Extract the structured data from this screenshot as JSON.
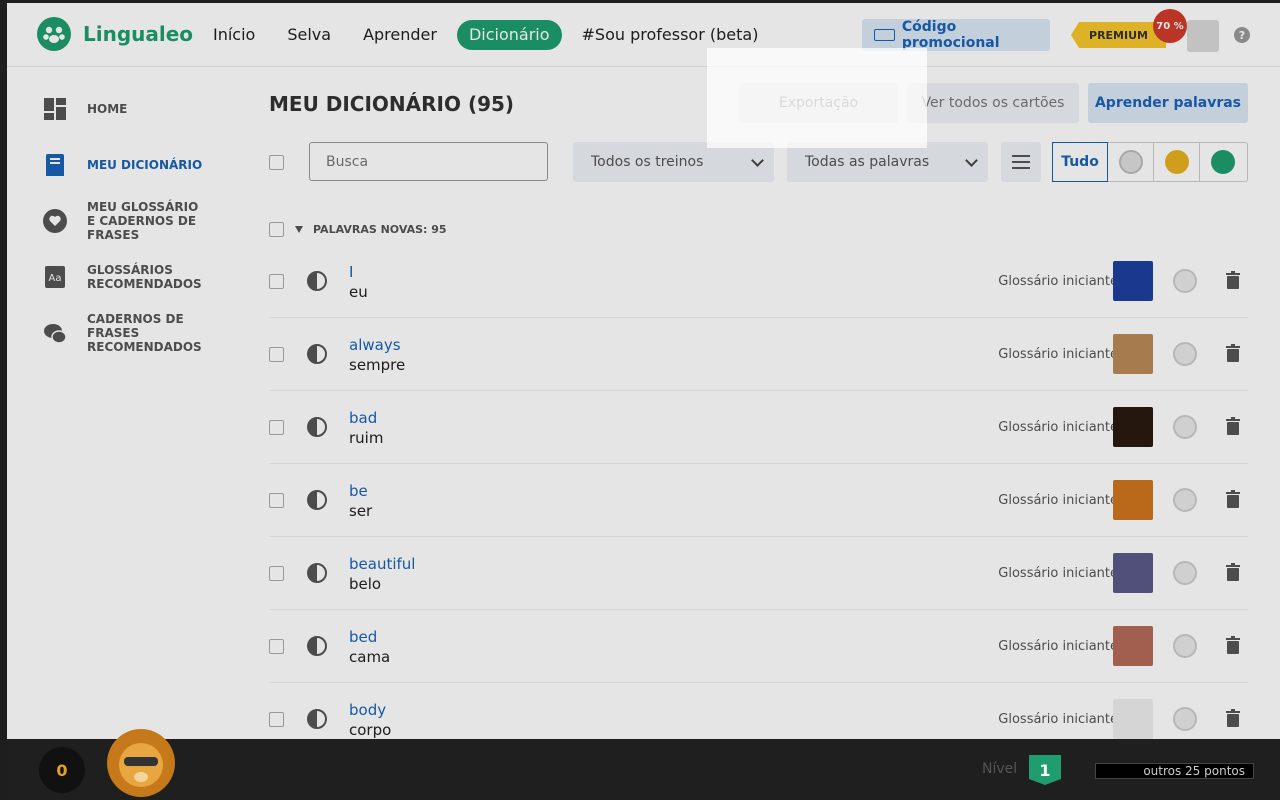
{
  "header": {
    "logo_text": "Lingualeo",
    "nav": [
      "Início",
      "Selva",
      "Aprender",
      "Dicionário",
      "#Sou professor (beta)"
    ],
    "promo_label": "Código promocional",
    "premium_label": "PREMIUM",
    "discount_label": "70 %",
    "help_label": "?"
  },
  "sidebar": {
    "items": [
      {
        "label": "HOME",
        "icon": "dashboard-icon"
      },
      {
        "label": "MEU DICIONÁRIO",
        "icon": "dictionary-icon"
      },
      {
        "label": "MEU GLOSSÁRIO\nE CADERNOS DE\nFRASES",
        "icon": "heart-icon"
      },
      {
        "label": "GLOSSÁRIOS\nRECOMENDADOS",
        "icon": "glossary-icon"
      },
      {
        "label": "CADERNOS DE FRASES\nRECOMENDADOS",
        "icon": "chat-icon"
      }
    ]
  },
  "main": {
    "title": "MEU DICIONÁRIO (95)",
    "export_label": "Exportação",
    "cards_label": "Ver todos os cartões",
    "learn_label": "Aprender palavras",
    "search_placeholder": "Busca",
    "trainings_select": "Todos os treinos",
    "words_select": "Todas as palavras",
    "filter_all": "Tudo",
    "group_label": "PALAVRAS NOVAS: 95"
  },
  "words": [
    {
      "en": "I",
      "pt": "eu",
      "glossary": "Glossário iniciante"
    },
    {
      "en": "always",
      "pt": "sempre",
      "glossary": "Glossário iniciante"
    },
    {
      "en": "bad",
      "pt": "ruim",
      "glossary": "Glossário iniciante"
    },
    {
      "en": "be",
      "pt": "ser",
      "glossary": "Glossário iniciante"
    },
    {
      "en": "beautiful",
      "pt": "belo",
      "glossary": "Glossário iniciante"
    },
    {
      "en": "bed",
      "pt": "cama",
      "glossary": "Glossário iniciante"
    },
    {
      "en": "body",
      "pt": "corpo",
      "glossary": "Glossário iniciante"
    }
  ],
  "bottom": {
    "coins": "0",
    "level_label": "Nível",
    "level": "1",
    "points": "outros 25 pontos"
  },
  "colors": {
    "brand": "#1f9d6e",
    "link": "#1a63b8",
    "premium": "#f6c72b"
  }
}
